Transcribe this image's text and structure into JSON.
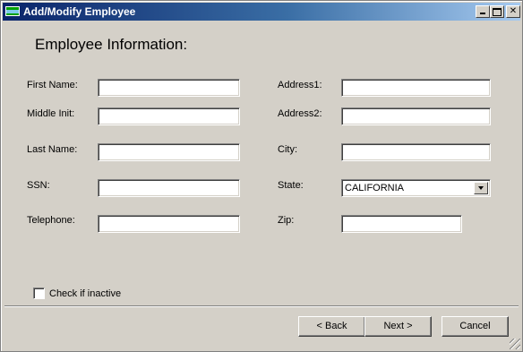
{
  "window": {
    "title": "Add/Modify Employee",
    "close_glyph": "✕"
  },
  "form": {
    "heading": "Employee Information:",
    "fields": {
      "first_name": {
        "label": "First Name:",
        "value": ""
      },
      "middle_init": {
        "label": "Middle Init:",
        "value": ""
      },
      "last_name": {
        "label": "Last Name:",
        "value": ""
      },
      "ssn": {
        "label": "SSN:",
        "value": ""
      },
      "telephone": {
        "label": "Telephone:",
        "value": ""
      },
      "address1": {
        "label": "Address1:",
        "value": ""
      },
      "address2": {
        "label": "Address2:",
        "value": ""
      },
      "city": {
        "label": "City:",
        "value": ""
      },
      "state": {
        "label": "State:",
        "value": "CALIFORNIA"
      },
      "zip": {
        "label": "Zip:",
        "value": ""
      }
    },
    "inactive_checkbox": {
      "label": "Check if inactive",
      "checked": false
    }
  },
  "buttons": {
    "back": "< Back",
    "next": "Next >",
    "cancel": "Cancel"
  },
  "icons": {
    "app": "app-icon",
    "minimize": "minimize-icon",
    "maximize": "maximize-icon",
    "close": "close-icon",
    "dropdown": "chevron-down-icon"
  },
  "colors": {
    "title_start": "#0a246a",
    "title_end": "#a6caf0",
    "face": "#d4d0c8"
  }
}
